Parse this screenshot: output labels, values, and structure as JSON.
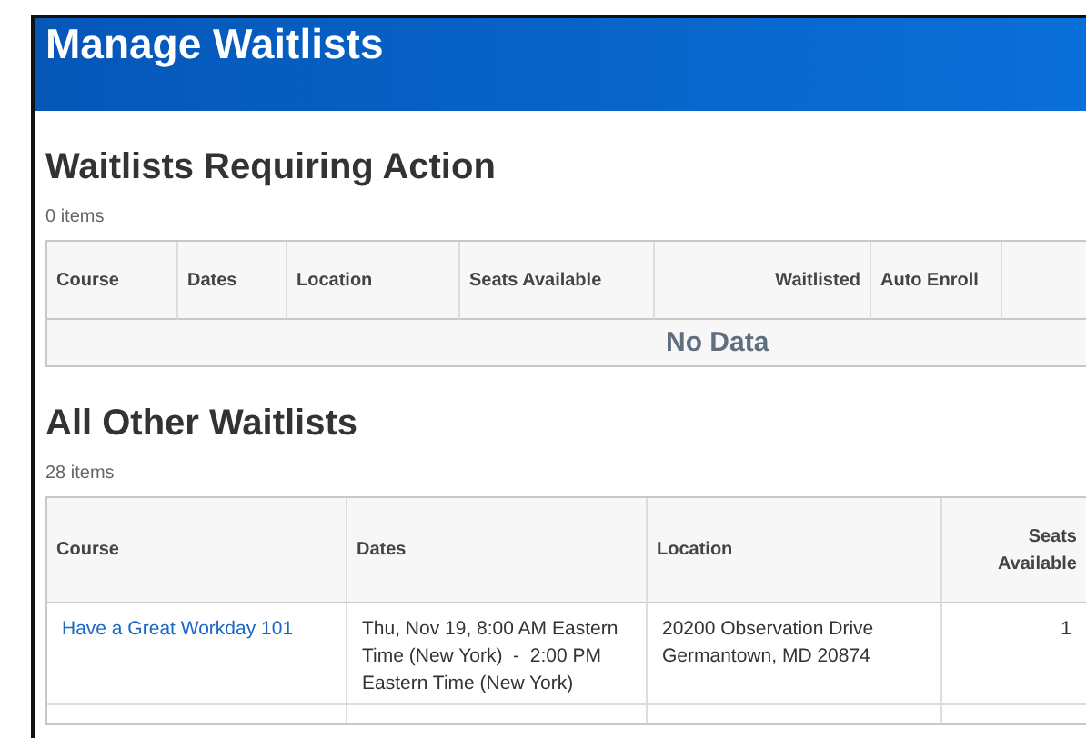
{
  "header": {
    "title": "Manage Waitlists"
  },
  "sections": [
    {
      "heading": "Waitlists Requiring Action",
      "count": "0 items",
      "columns": [
        {
          "label": "Course"
        },
        {
          "label": "Dates"
        },
        {
          "label": "Location"
        },
        {
          "label": "Seats Available"
        },
        {
          "label": "Waitlisted"
        },
        {
          "label": "Auto Enroll"
        }
      ],
      "empty_text": "No Data"
    },
    {
      "heading": "All Other Waitlists",
      "count": "28 items",
      "columns": [
        {
          "label": "Course"
        },
        {
          "label": "Dates"
        },
        {
          "label": "Location"
        },
        {
          "label": "Seats Available"
        }
      ],
      "rows": [
        {
          "course": "Have a Great Workday 101",
          "dates": "Thu, Nov 19, 8:00 AM Eastern Time (New York)  -  2:00 PM Eastern Time (New York)",
          "location": "20200 Observation Drive Germantown, MD 20874",
          "seats": "1"
        }
      ]
    }
  ]
}
